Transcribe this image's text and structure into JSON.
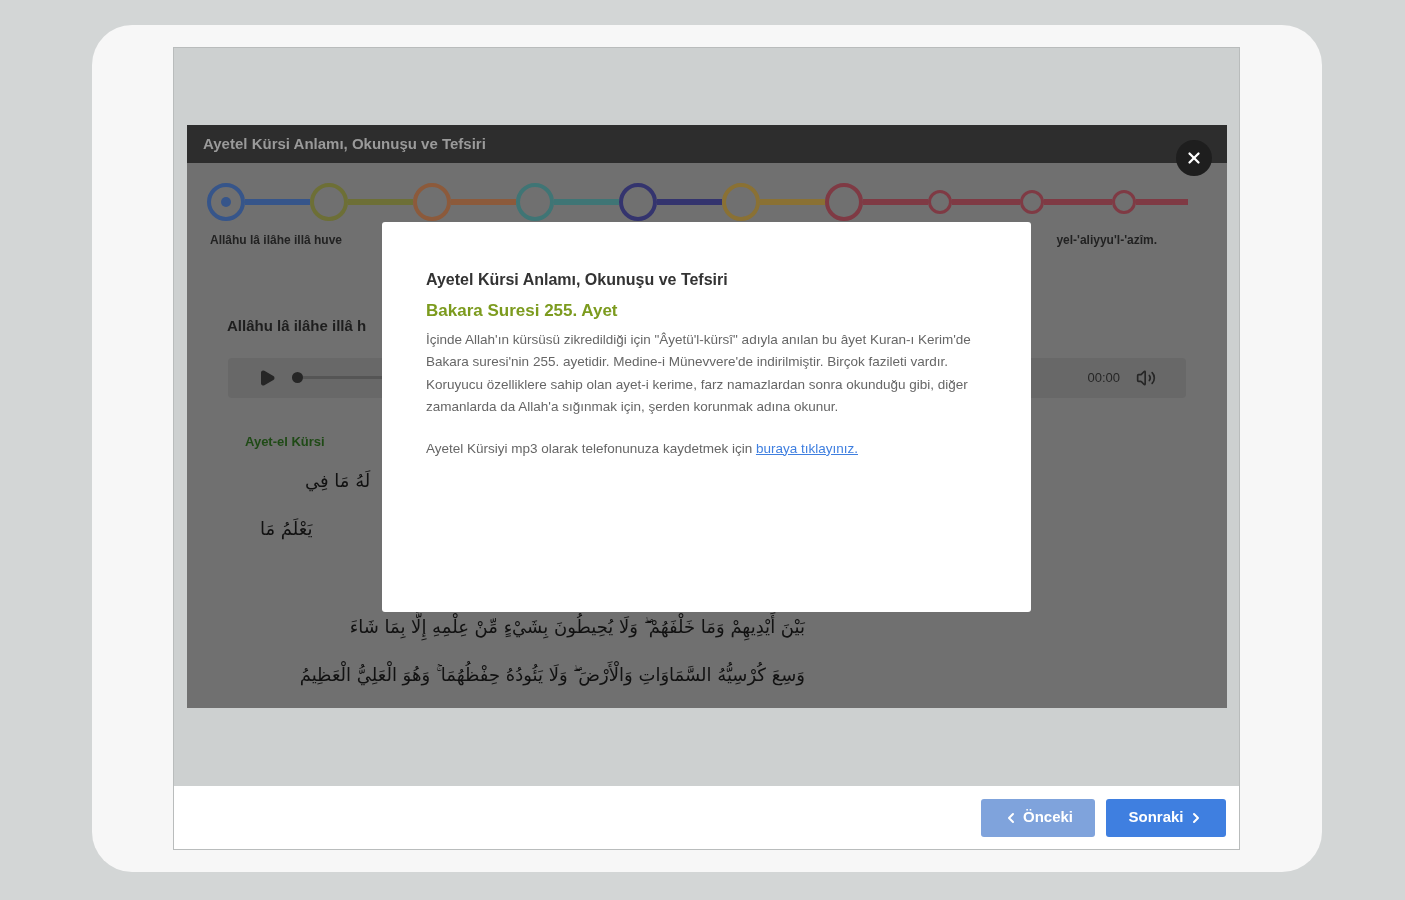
{
  "dialog": {
    "title": "Ayetel Kürsi Anlamı, Okunuşu ve Tefsiri",
    "steps": [
      {
        "color": "#36558a",
        "selected": true,
        "kind": "large"
      },
      {
        "color": "#6d6f36",
        "selected": false,
        "kind": "large"
      },
      {
        "color": "#8c5a3b",
        "selected": false,
        "kind": "large"
      },
      {
        "color": "#3f7575",
        "selected": false,
        "kind": "large"
      },
      {
        "color": "#34346e",
        "selected": false,
        "kind": "large"
      },
      {
        "color": "#8a7134",
        "selected": false,
        "kind": "large"
      },
      {
        "color": "#7f3a44",
        "selected": false,
        "kind": "large"
      },
      {
        "color": "#7f3a44",
        "selected": false,
        "kind": "small"
      },
      {
        "color": "#7f3a44",
        "selected": false,
        "kind": "small"
      },
      {
        "color": "#7f3a44",
        "selected": false,
        "kind": "small"
      }
    ],
    "step_labels": [
      "Allâhu lâ ilâhe illâ huve",
      "yel-'aliyyu'l-'azîm."
    ],
    "heading": "Allâhu lâ ilâhe illâ h",
    "player": {
      "time": "00:00",
      "level": 0
    },
    "section_label": "Ayet-el Kürsi",
    "arabic_lines": [
      "لَهُ مَا فِي",
      "يَعْلَمُ مَا",
      "بَيْنَ أَيْدِيهِمْ وَمَا خَلْفَهُمْ ۖ وَلَا يُحِيطُونَ بِشَيْءٍ مِّنْ عِلْمِهِ إِلَّا بِمَا شَاءَ",
      "وَسِعَ كُرْسِيُّهُ السَّمَاوَاتِ وَالْأَرْضَ ۖ وَلَا يَئُودُهُ حِفْظُهُمَا ۚ وَهُوَ الْعَلِيُّ الْعَظِيمُ"
    ]
  },
  "modal": {
    "title": "Ayetel Kürsi Anlamı, Okunuşu ve Tefsiri",
    "subtitle": "Bakara Suresi 255. Ayet",
    "paragraph": "İçinde Allah'ın kürsüsü zikredildiği için \"Âyetü'l-kürsî\" adıyla anılan bu âyet Kuran-ı Kerim'de Bakara suresi'nin 255. ayetidir. Medine-i Münevvere'de indirilmiştir. Birçok fazileti vardır. Koruyucu özelliklere sahip olan ayet-i kerime, farz namazlardan sonra okunduğu gibi, diğer zamanlarda da Allah'a sığınmak için, şerden korunmak adına okunur.",
    "download_text": "Ayetel Kürsiyi mp3 olarak telefonunuza kaydetmek için",
    "download_link": "buraya tıklayınız."
  },
  "nav": {
    "prev": {
      "label": "Önceki",
      "disabled": true
    },
    "next": {
      "label": "Sonraki",
      "disabled": false
    }
  }
}
